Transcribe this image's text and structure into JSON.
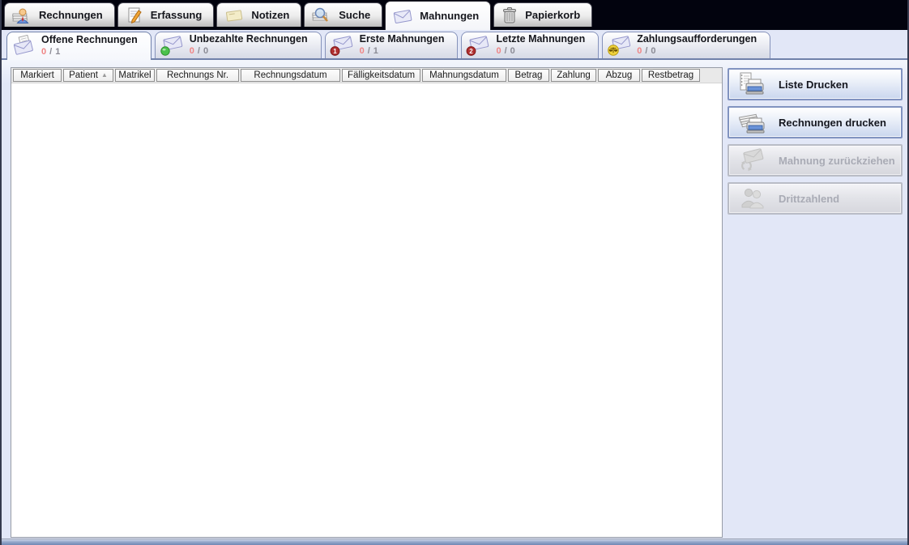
{
  "window_title": "Mahnungen",
  "main_tabs": [
    {
      "label": "Rechnungen",
      "selected": false
    },
    {
      "label": "Erfassung",
      "selected": false
    },
    {
      "label": "Notizen",
      "selected": false
    },
    {
      "label": "Suche",
      "selected": false
    },
    {
      "label": "Mahnungen",
      "selected": true
    },
    {
      "label": "Papierkorb",
      "selected": false
    }
  ],
  "subtabs": [
    {
      "label": "Offene Rechnungen",
      "marked": "0",
      "total": "1",
      "selected": true
    },
    {
      "label": "Unbezahlte Rechnungen",
      "marked": "0",
      "total": "0",
      "selected": false
    },
    {
      "label": "Erste Mahnungen",
      "marked": "0",
      "total": "1",
      "selected": false
    },
    {
      "label": "Letzte Mahnungen",
      "marked": "0",
      "total": "0",
      "selected": false
    },
    {
      "label": "Zahlungsaufforderungen",
      "marked": "0",
      "total": "0",
      "selected": false
    }
  ],
  "count_separator": "/",
  "table": {
    "columns": [
      {
        "label": "Markiert"
      },
      {
        "label": "Patient",
        "sorted": "asc"
      },
      {
        "label": "Matrikel"
      },
      {
        "label": "Rechnungs Nr."
      },
      {
        "label": "Rechnungsdatum"
      },
      {
        "label": "Fälligkeitsdatum"
      },
      {
        "label": "Mahnungsdatum"
      },
      {
        "label": "Betrag"
      },
      {
        "label": "Zahlung"
      },
      {
        "label": "Abzug"
      },
      {
        "label": "Restbetrag"
      }
    ],
    "rows": []
  },
  "actions": [
    {
      "label": "Liste Drucken",
      "enabled": true
    },
    {
      "label": "Rechnungen drucken",
      "enabled": true
    },
    {
      "label": "Mahnung zurückziehen",
      "enabled": false
    },
    {
      "label": "Drittzahlend",
      "enabled": false
    }
  ],
  "icons": {
    "rechnungen": "papers-person",
    "erfassung": "document-pencil",
    "notizen": "sticky-note",
    "suche": "search-papers",
    "mahnungen": "envelope",
    "papierkorb": "trash-can",
    "offene_rechnungen": "envelope-letter",
    "unbezahlte_rechnungen": "envelope-green-dot",
    "erste_mahnungen": "envelope-badge-1",
    "letzte_mahnungen": "envelope-badge-2",
    "zahlungsaufforderungen": "envelope-scales",
    "liste_drucken": "printer-list",
    "rechnungen_drucken": "printer-stack",
    "mahnung_zurueckziehen": "envelope-undo",
    "drittzahlend": "people-group",
    "sort_ascending": "▲"
  },
  "colors": {
    "topbar_bg": "#02030e",
    "content_bg": "#e2e7f7",
    "marked_count": "#ef8585",
    "total_count": "#8b8b95",
    "button_border": "#8193c0",
    "button_bg_bottom": "#c9d6ee",
    "disabled_text": "#a9abb5",
    "subtab_border": "#7081aa"
  }
}
